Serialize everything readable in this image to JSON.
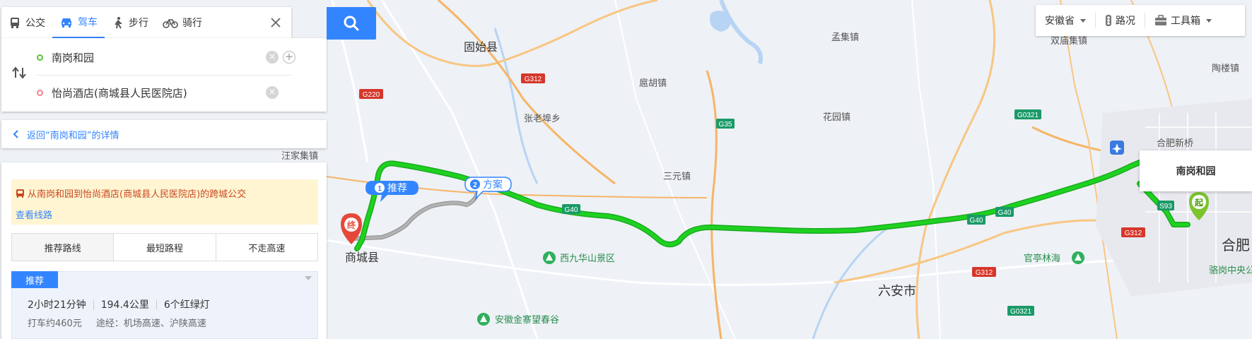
{
  "modes": [
    {
      "label": "公交",
      "icon": "bus-icon"
    },
    {
      "label": "驾车",
      "icon": "car-icon",
      "active": true
    },
    {
      "label": "步行",
      "icon": "walk-icon"
    },
    {
      "label": "骑行",
      "icon": "bike-icon"
    }
  ],
  "route": {
    "start": "南岗和园",
    "end": "怡尚酒店(商城县人民医院店)"
  },
  "back_link": "返回“南岗和园”的详情",
  "notice": {
    "line1": "从南岗和园到怡尚酒店(商城县人民医院店)的跨城公交",
    "line2": "查看线路"
  },
  "tabs": [
    "推荐路线",
    "最短路程",
    "不走高速"
  ],
  "plan": {
    "tag": "推荐",
    "duration": "2小时21分钟",
    "distance": "194.4公里",
    "lights": "6个红绿灯",
    "taxi": "打车约460元",
    "via": "途经：机场高速、沪陕高速"
  },
  "toolbar": {
    "province": "安徽省",
    "traffic": "路况",
    "tools": "工具箱"
  },
  "map": {
    "popup": "南岗和园",
    "start_marker": "起",
    "end_marker": "终",
    "badges": {
      "recommend": "推荐",
      "plan": "方案",
      "n1": "1",
      "n2": "2"
    },
    "places": {
      "gushi": "固始县",
      "shangcheng": "商城县",
      "luan": "六安市",
      "hefei": "合肥",
      "mengji": "孟集镇",
      "shuangmiao": "双庙集镇",
      "taolou": "陶楼镇",
      "hufu": "扈胡镇",
      "zhanglao": "张老埠乡",
      "huayuan": "花园镇",
      "sanyuan": "三元镇",
      "jiangjia": "汪家集镇",
      "xijiuhua": "西九华山景区",
      "guanting": "官亭林海",
      "luogang": "骆岗中央公",
      "jinzhai": "安徽金寨望春谷",
      "hefei_new": "合肥新桥"
    },
    "shields": {
      "g312": "G312",
      "g220": "G220",
      "g35": "G35",
      "g0321": "G0321",
      "g40": "G40",
      "s93": "S93"
    }
  }
}
